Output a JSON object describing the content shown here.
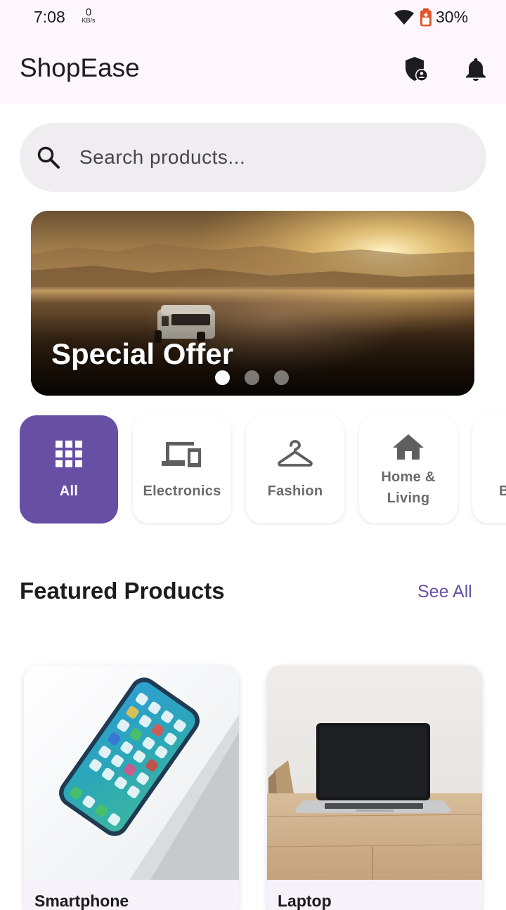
{
  "status_bar": {
    "time": "7:08",
    "net_speed": "0",
    "net_unit": "KB/s",
    "battery": "30%"
  },
  "app_bar": {
    "title": "ShopEase",
    "icons": [
      "shield-account-icon",
      "bell-icon"
    ]
  },
  "search": {
    "placeholder": "Search products..."
  },
  "banner": {
    "title": "Special Offer",
    "slides": 3,
    "active_slide": 1
  },
  "categories": [
    {
      "label": "All",
      "icon": "grid-icon",
      "active": true
    },
    {
      "label": "Electronics",
      "icon": "devices-icon",
      "active": false
    },
    {
      "label": "Fashion",
      "icon": "hanger-icon",
      "active": false
    },
    {
      "label": "Home & Living",
      "icon": "home-icon",
      "active": false
    },
    {
      "label": "B",
      "icon": "",
      "active": false
    }
  ],
  "featured": {
    "title": "Featured Products",
    "see_all": "See All",
    "products": [
      {
        "name": "Smartphone"
      },
      {
        "name": "Laptop"
      }
    ]
  },
  "colors": {
    "primary": "#6750a4",
    "surface": "#fdf7fd",
    "search_bg": "#efedf0",
    "card_bg": "#f7f2fa"
  }
}
